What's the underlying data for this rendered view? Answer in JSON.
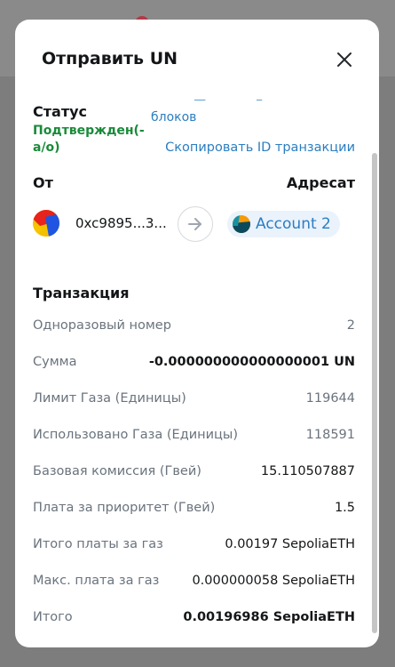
{
  "modal": {
    "title": "Отправить UN"
  },
  "status": {
    "label": "Статус",
    "blocks_text": "блоков",
    "value": "Подтвержден(-а/о)",
    "copy_tx_id": "Скопировать ID транзакции"
  },
  "parties": {
    "from_label": "От",
    "to_label": "Адресат",
    "from_address": "0xc9895...3...",
    "recipient_name": "Account 2"
  },
  "transaction": {
    "heading": "Транзакция",
    "rows": [
      {
        "label": "Одноразовый номер",
        "value": "2"
      },
      {
        "label": "Сумма",
        "value": "-0.000000000000000001 UN"
      },
      {
        "label": "Лимит Газа (Единицы)",
        "value": "119644"
      },
      {
        "label": "Использовано Газа (Единицы)",
        "value": "118591"
      },
      {
        "label": "Базовая комиссия (Гвей)",
        "value": "15.110507887"
      },
      {
        "label": "Плата за приоритет (Гвей)",
        "value": "1.5"
      },
      {
        "label": "Итого платы за газ",
        "value": "0.00197 SepoliaETH"
      },
      {
        "label": "Макс. плата за газ",
        "value": "0.000000058 SepoliaETH"
      },
      {
        "label": "Итого",
        "value": "0.00196986 SepoliaETH"
      }
    ]
  },
  "colors": {
    "link": "#2b7ec1",
    "success": "#1a8a3a",
    "recipient_pill_bg": "#eaf2fb"
  }
}
